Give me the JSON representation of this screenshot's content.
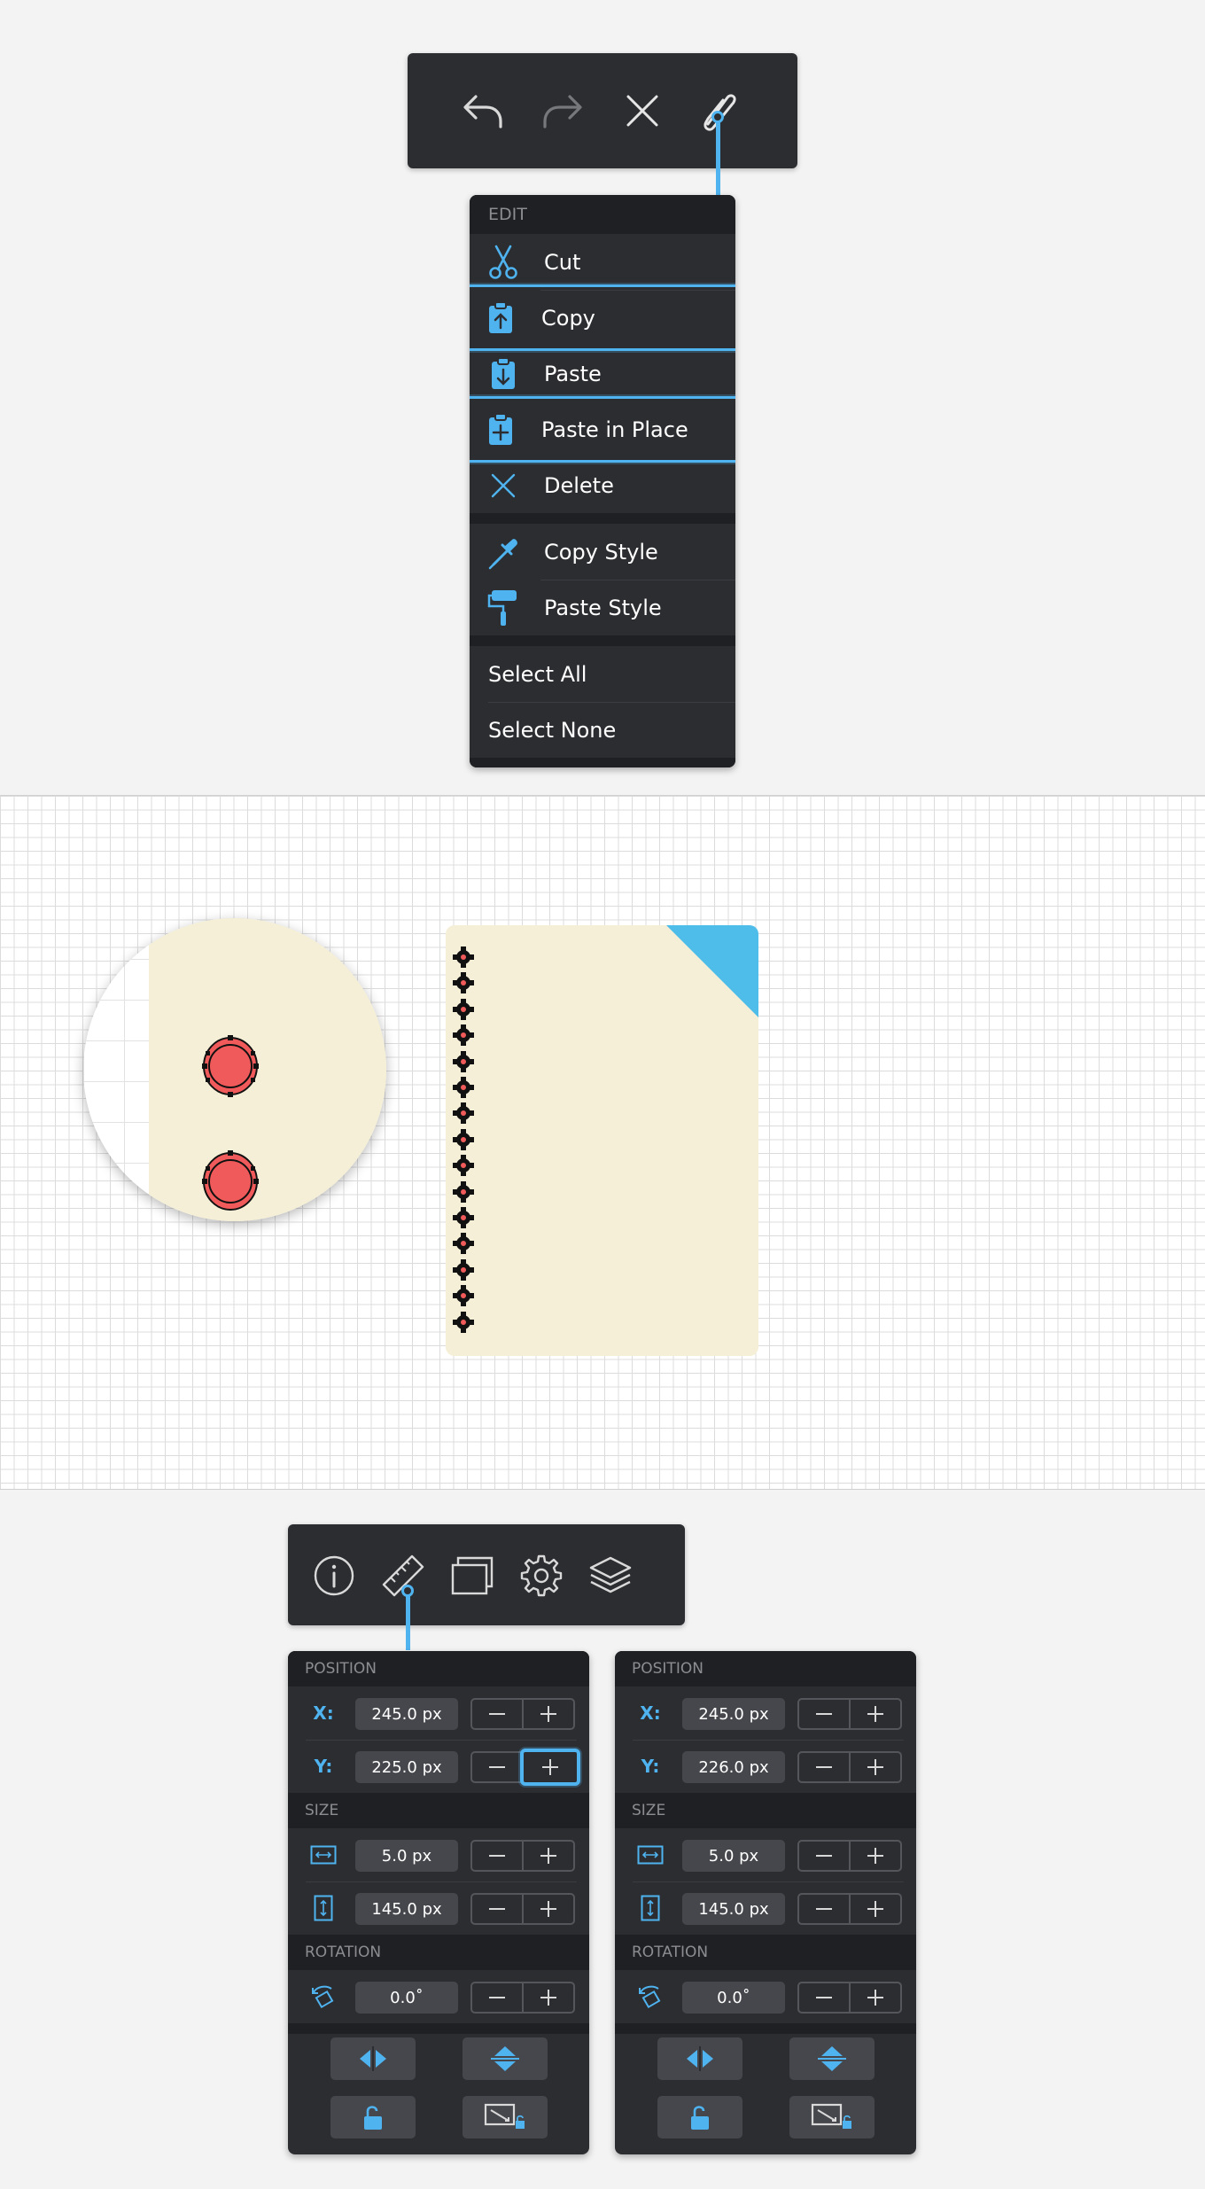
{
  "edit_menu": {
    "header": "EDIT",
    "items": [
      {
        "label": "Cut",
        "icon": "scissors-icon"
      },
      {
        "label": "Copy",
        "icon": "clipboard-copy-icon",
        "highlighted": true
      },
      {
        "label": "Paste",
        "icon": "clipboard-paste-icon"
      },
      {
        "label": "Paste in Place",
        "icon": "clipboard-paste-in-place-icon",
        "highlighted": true
      },
      {
        "label": "Delete",
        "icon": "delete-x-icon"
      },
      {
        "label": "Copy Style",
        "icon": "eyedropper-icon"
      },
      {
        "label": "Paste Style",
        "icon": "paint-roller-icon"
      },
      {
        "label": "Select All"
      },
      {
        "label": "Select None"
      }
    ]
  },
  "top_toolbar": {
    "buttons": [
      "undo-icon",
      "redo-icon",
      "close-icon",
      "paperclip-icon"
    ],
    "active": "paperclip-icon"
  },
  "bottom_toolbar": {
    "buttons": [
      "info-icon",
      "ruler-icon",
      "layers-copy-icon",
      "gear-icon",
      "stack-icon"
    ],
    "active": "ruler-icon"
  },
  "inspector_left": {
    "position_header": "POSITION",
    "x_label": "X:",
    "x_value": "245.0 px",
    "y_label": "Y:",
    "y_value": "225.0 px",
    "size_header": "SIZE",
    "width_value": "5.0 px",
    "height_value": "145.0 px",
    "rotation_header": "ROTATION",
    "rotation_value": "0.0˚"
  },
  "inspector_right": {
    "position_header": "POSITION",
    "x_label": "X:",
    "x_value": "245.0 px",
    "y_label": "Y:",
    "y_value": "226.0 px",
    "size_header": "SIZE",
    "width_value": "5.0 px",
    "height_value": "145.0 px",
    "rotation_header": "ROTATION",
    "rotation_value": "0.0˚"
  },
  "colors": {
    "accent": "#4fb3ef",
    "panel": "#2c2d31",
    "note_paper": "#f4efd6",
    "note_corner": "#4ebdea",
    "hole_red": "#f05a5a"
  }
}
